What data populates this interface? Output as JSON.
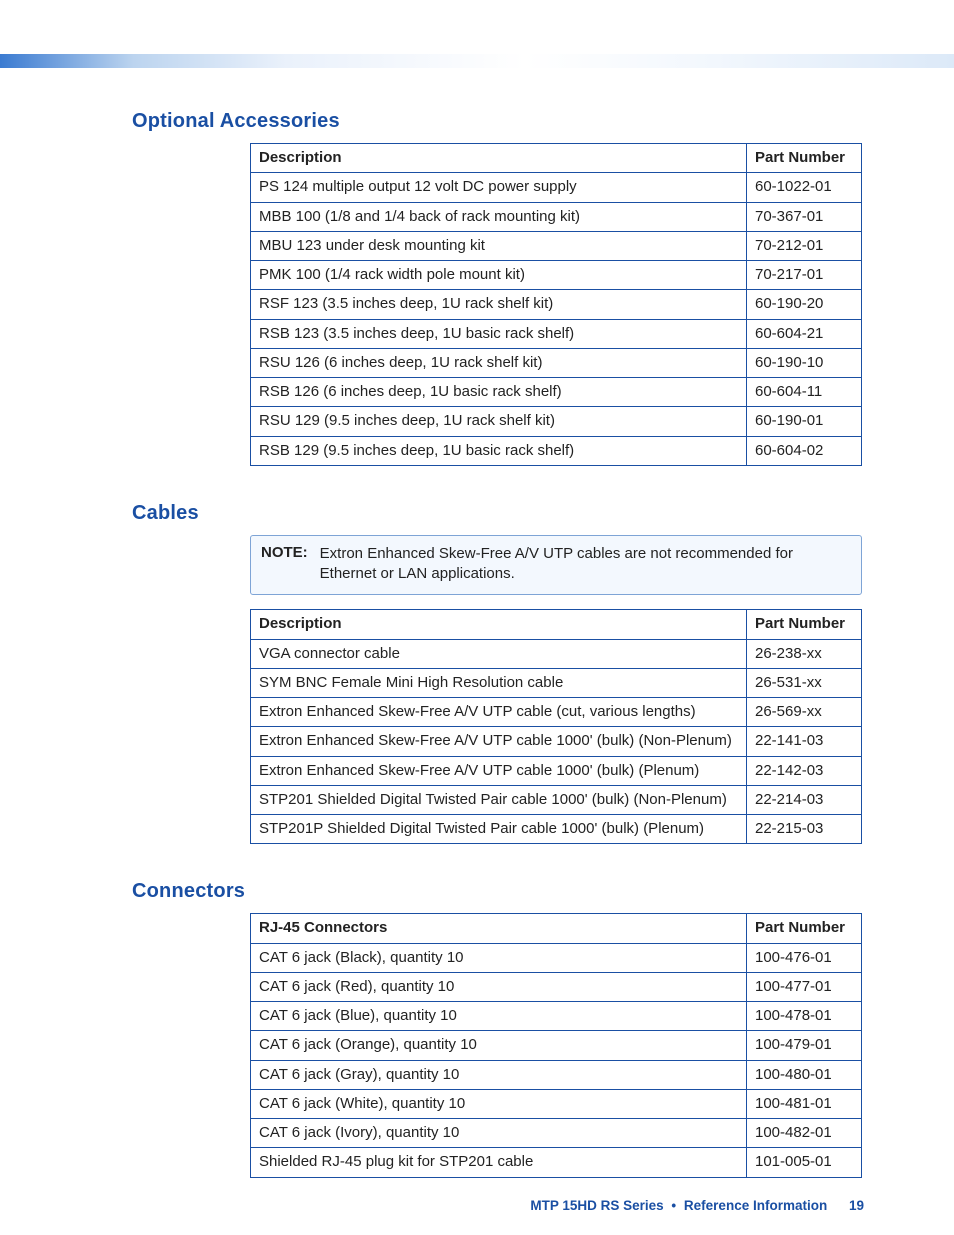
{
  "sections": {
    "accessories": {
      "heading": "Optional Accessories",
      "columns": {
        "desc": "Description",
        "part": "Part Number"
      },
      "rows": [
        {
          "desc": "PS 124 multiple output 12 volt DC power supply",
          "part": "60-1022-01"
        },
        {
          "desc": "MBB 100 (1/8 and 1/4 back of rack mounting kit)",
          "part": "70-367-01"
        },
        {
          "desc": "MBU 123 under desk mounting kit",
          "part": "70-212-01"
        },
        {
          "desc": "PMK 100 (1/4 rack width pole mount kit)",
          "part": "70-217-01"
        },
        {
          "desc": "RSF 123 (3.5 inches deep, 1U rack shelf kit)",
          "part": "60-190-20"
        },
        {
          "desc": "RSB 123 (3.5 inches deep, 1U basic rack shelf)",
          "part": "60-604-21"
        },
        {
          "desc": "RSU 126 (6 inches deep, 1U rack shelf kit)",
          "part": "60-190-10"
        },
        {
          "desc": "RSB 126 (6 inches deep, 1U basic rack shelf)",
          "part": "60-604-11"
        },
        {
          "desc": "RSU 129 (9.5 inches deep, 1U rack shelf kit)",
          "part": "60-190-01"
        },
        {
          "desc": "RSB 129 (9.5 inches deep, 1U basic rack shelf)",
          "part": "60-604-02"
        }
      ]
    },
    "cables": {
      "heading": "Cables",
      "note": {
        "label": "NOTE:",
        "text": "Extron Enhanced Skew-Free A/V UTP cables are not recommended for Ethernet or LAN applications."
      },
      "columns": {
        "desc": "Description",
        "part": "Part Number"
      },
      "rows": [
        {
          "desc": "VGA connector cable",
          "part": "26-238-xx"
        },
        {
          "desc": "SYM BNC Female Mini High Resolution cable",
          "part": "26-531-xx"
        },
        {
          "desc": "Extron Enhanced Skew-Free A/V UTP cable (cut, various lengths)",
          "part": "26-569-xx"
        },
        {
          "desc": "Extron Enhanced Skew-Free A/V UTP cable 1000' (bulk) (Non-Plenum)",
          "part": "22-141-03"
        },
        {
          "desc": "Extron Enhanced Skew-Free A/V UTP cable 1000' (bulk) (Plenum)",
          "part": "22-142-03"
        },
        {
          "desc": "STP201 Shielded Digital Twisted Pair cable 1000' (bulk) (Non-Plenum)",
          "part": "22-214-03"
        },
        {
          "desc": "STP201P Shielded Digital Twisted Pair cable 1000' (bulk) (Plenum)",
          "part": "22-215-03"
        }
      ]
    },
    "connectors": {
      "heading": "Connectors",
      "columns": {
        "desc": "RJ-45 Connectors",
        "part": "Part Number"
      },
      "rows": [
        {
          "desc": "CAT 6 jack (Black), quantity 10",
          "part": "100-476-01"
        },
        {
          "desc": "CAT 6 jack (Red), quantity 10",
          "part": "100-477-01"
        },
        {
          "desc": "CAT 6 jack (Blue), quantity 10",
          "part": "100-478-01"
        },
        {
          "desc": "CAT 6 jack (Orange), quantity 10",
          "part": "100-479-01"
        },
        {
          "desc": "CAT 6 jack (Gray), quantity 10",
          "part": "100-480-01"
        },
        {
          "desc": "CAT 6 jack (White), quantity 10",
          "part": "100-481-01"
        },
        {
          "desc": "CAT 6 jack (Ivory), quantity 10",
          "part": "100-482-01"
        },
        {
          "desc": "Shielded RJ-45 plug kit for STP201 cable",
          "part": "101-005-01"
        }
      ]
    }
  },
  "footer": {
    "series": "MTP 15HD RS Series",
    "sep": "•",
    "section": "Reference Information",
    "page": "19"
  }
}
